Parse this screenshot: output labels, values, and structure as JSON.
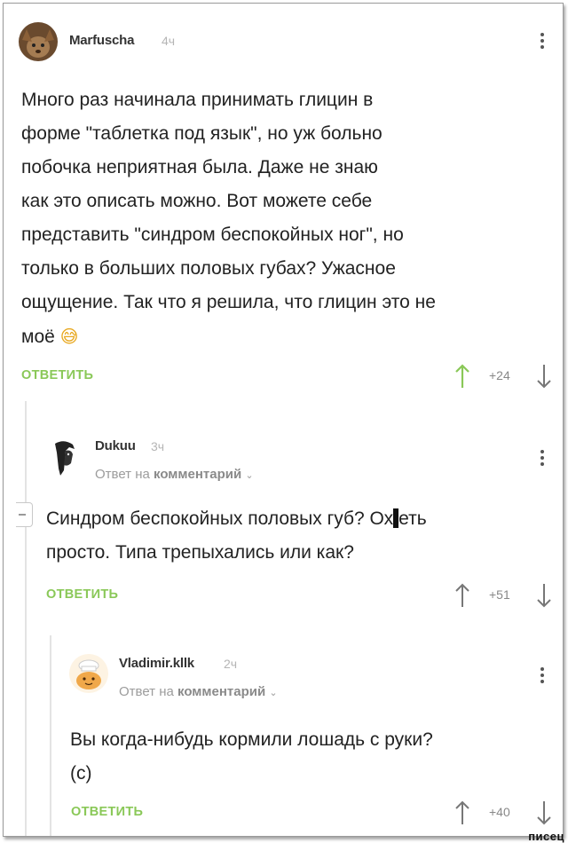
{
  "comments": [
    {
      "username": "Marfuscha",
      "time": "4ч",
      "text_lines": [
        "Много раз начинала принимать глицин в",
        "форме \"таблетка под язык\", но уж больно",
        "побочка неприятная была. Даже не знаю",
        "как это описать можно. Вот можете себе",
        "представить \"синдром беспокойных ног\", но",
        "только в больших половых губах? Ужасное",
        "ощущение. Так что я решила, что глицин это не",
        "моё"
      ],
      "emoji": "😅",
      "reply_label": "ОТВЕТИТЬ",
      "score": "+24"
    },
    {
      "username": "Dukuu",
      "time": "3ч",
      "reply_prefix": "Ответ на",
      "reply_target": "комментарий",
      "text_line1_before": "Синдром беспокойных половых губ? Ох",
      "text_line1_after": "еть",
      "text_line2": "просто. Типа трепыхались или как?",
      "reply_label": "ОТВЕТИТЬ",
      "score": "+51"
    },
    {
      "username": "Vladimir.kllk",
      "time": "2ч",
      "reply_prefix": "Ответ на",
      "reply_target": "комментарий",
      "text_lines": [
        "Вы когда-нибудь кормили лошадь с руки?",
        "(с)"
      ],
      "reply_label": "ОТВЕТИТЬ",
      "score": "+40"
    }
  ],
  "colors": {
    "accent": "#8ac858",
    "upvote": "#8ac858",
    "muted": "#b5b5b5"
  },
  "watermark": "писец"
}
